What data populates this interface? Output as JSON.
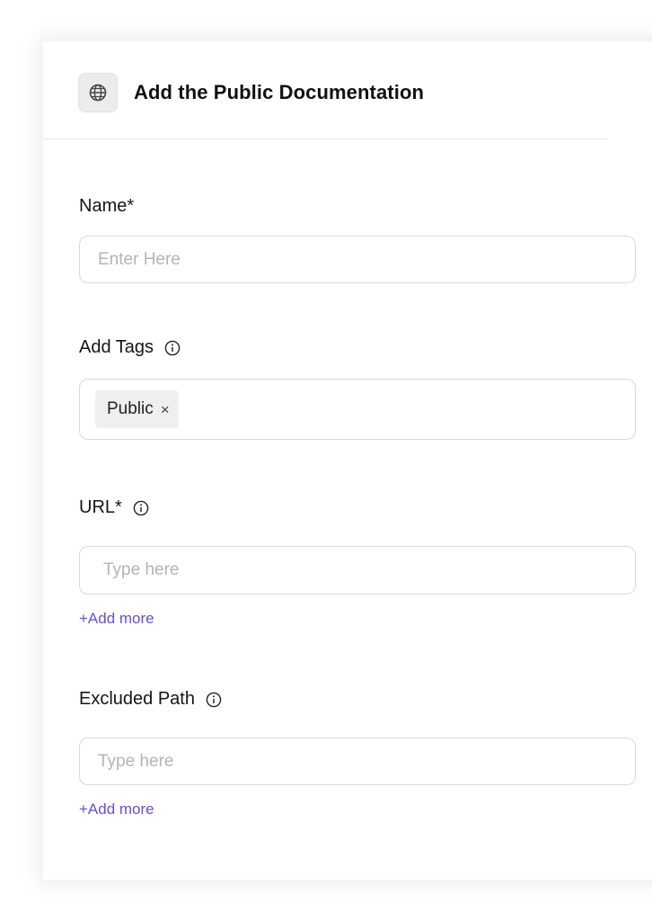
{
  "header": {
    "title": "Add the Public Documentation",
    "icon": "globe-icon"
  },
  "form": {
    "name": {
      "label": "Name*",
      "placeholder": "Enter Here",
      "value": ""
    },
    "tags": {
      "label": "Add Tags",
      "items": [
        {
          "label": "Public",
          "remove_symbol": "×"
        }
      ]
    },
    "url": {
      "label": "URL*",
      "placeholder": "Type here",
      "value": "",
      "add_more": "+Add more"
    },
    "excluded_path": {
      "label": "Excluded Path",
      "placeholder": "Type here",
      "value": "",
      "add_more": "+Add more"
    }
  },
  "colors": {
    "accent": "#6c4cd8",
    "border": "#d9d9dd",
    "tag_bg": "#efeff1",
    "icon_bg": "#ececef"
  }
}
